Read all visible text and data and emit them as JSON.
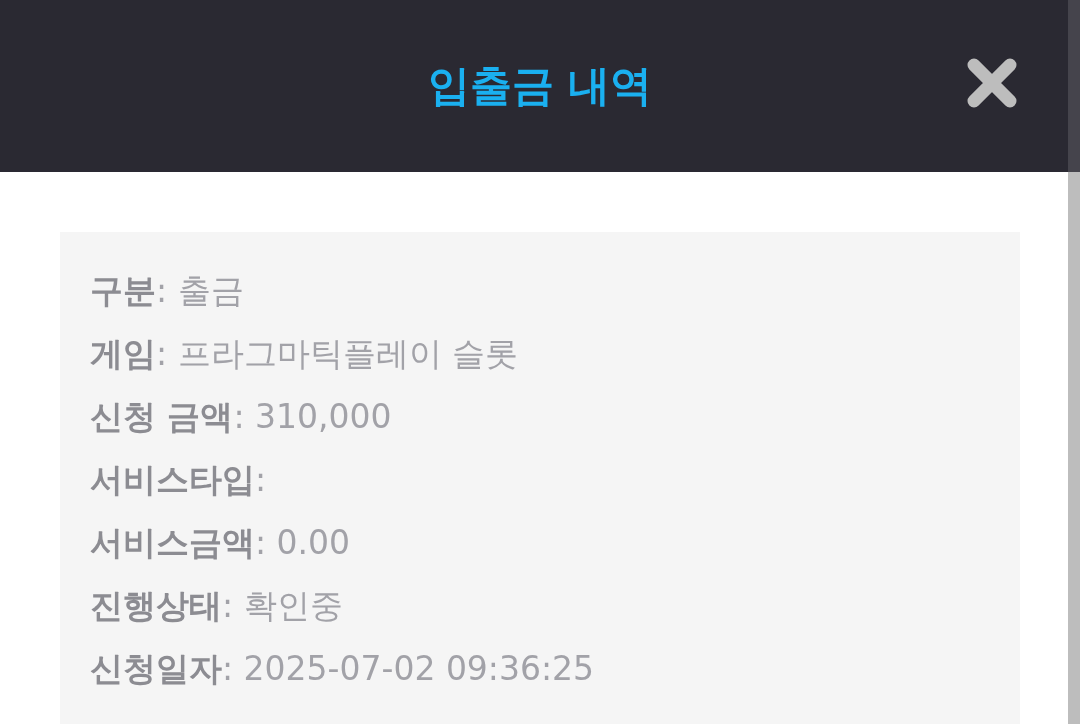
{
  "header": {
    "title": "입출금 내역"
  },
  "details": [
    {
      "text": "**구분**: 출금"
    },
    {
      "text": "**게임**: 프라그마틱플레이 슬롯"
    },
    {
      "text": "**신청 금액**: 310,000"
    },
    {
      "text": "**서비스타입**:"
    },
    {
      "text": "**서비스금액**: 0.00"
    },
    {
      "text": "**진행상태**: 확인중"
    },
    {
      "text": "**신청일자**: 2025-07-02 09:36:25"
    }
  ]
}
